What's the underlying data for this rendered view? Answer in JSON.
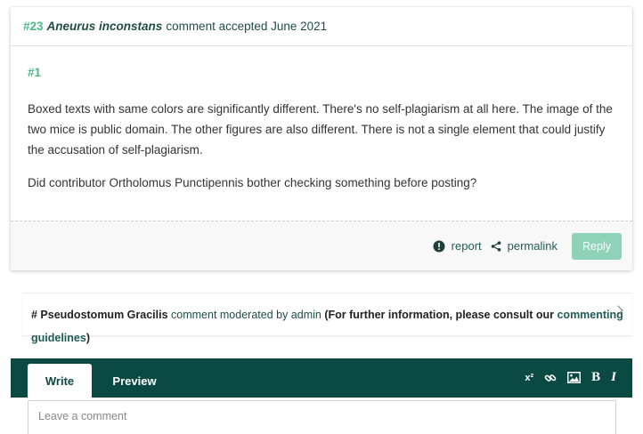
{
  "comment": {
    "number": "#23",
    "author": "Aneurus inconstans",
    "status": "comment accepted June 2021",
    "reply_number": "#1",
    "paragraphs": [
      "Boxed texts with same colors are significantly different. There's no self-plagiarism at all here. The image of the two mice is public domain. The other figures are also different. There is not a single element that could justify the accusation of self-plagiarism.",
      "Did contributor Ortholomus Punctipennis bother checking something before posting?"
    ],
    "actions": {
      "report_label": "report",
      "permalink_label": "permalink",
      "reply_label": "Reply"
    }
  },
  "moderated": {
    "prefix": "# Pseudostomum Gracilis",
    "status": "comment moderated by admin",
    "info_text": "(For further information, please consult our",
    "link_part1": "commenting",
    "link_part2": "guidelines",
    "close_paren": ")"
  },
  "editor": {
    "tabs": [
      "Write",
      "Preview"
    ],
    "toolbar": [
      "superscript-icon",
      "link-icon",
      "image-icon",
      "bold-icon",
      "italic-icon"
    ],
    "superscript_label": "x²",
    "bold_label": "B",
    "italic_label": "I",
    "placeholder": "Leave a comment"
  },
  "colors": {
    "accent_green": "#4cb888",
    "dark_teal": "#0b4a42",
    "reply_button": "#8fd2ba",
    "link_teal": "#1f5c55"
  }
}
